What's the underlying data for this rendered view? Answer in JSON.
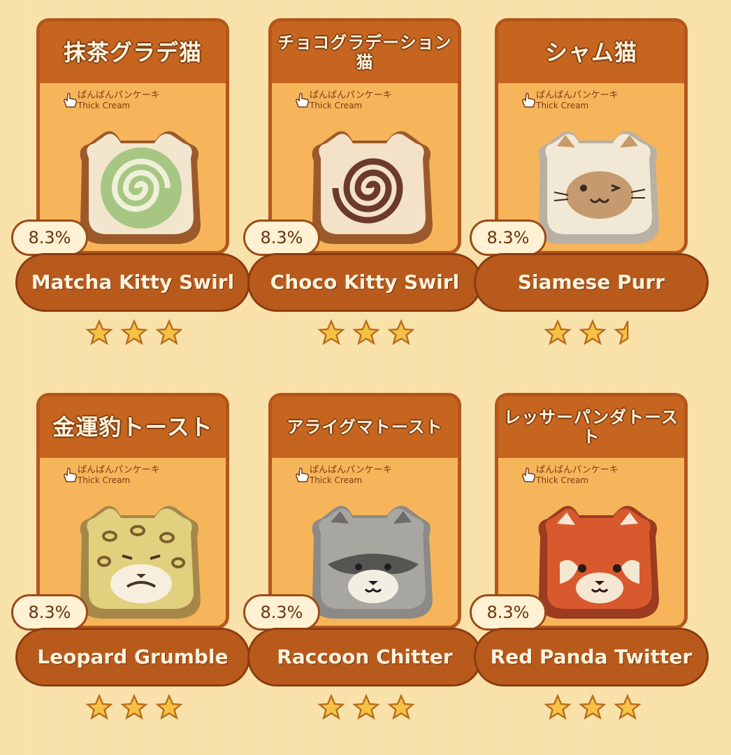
{
  "labels": {
    "subtitle_jp": "ぱんぱんパンケーキ",
    "subtitle_en": "Thick Cream"
  },
  "items": [
    {
      "jp": "抹茶グラデ猫",
      "en": "Matcha Kitty Swirl",
      "percent": "8.3%",
      "stars": 3,
      "art": "matcha-swirl"
    },
    {
      "jp": "チョコグラデーション猫",
      "en": "Choco Kitty Swirl",
      "percent": "8.3%",
      "stars": 3,
      "art": "choco-swirl"
    },
    {
      "jp": "シャム猫",
      "en": "Siamese Purr",
      "percent": "8.3%",
      "stars": 2.5,
      "art": "siamese"
    },
    {
      "jp": "金運豹トースト",
      "en": "Leopard Grumble",
      "percent": "8.3%",
      "stars": 3,
      "art": "leopard"
    },
    {
      "jp": "アライグマトースト",
      "en": "Raccoon Chitter",
      "percent": "8.3%",
      "stars": 3,
      "art": "raccoon"
    },
    {
      "jp": "レッサーパンダトースト",
      "en": "Red Panda Twitter",
      "percent": "8.3%",
      "stars": 3,
      "art": "red-panda"
    }
  ],
  "colors": {
    "background": "#f9e2aa",
    "card": "#f6b55a",
    "band": "#c6651f",
    "star": "#f6c245"
  }
}
